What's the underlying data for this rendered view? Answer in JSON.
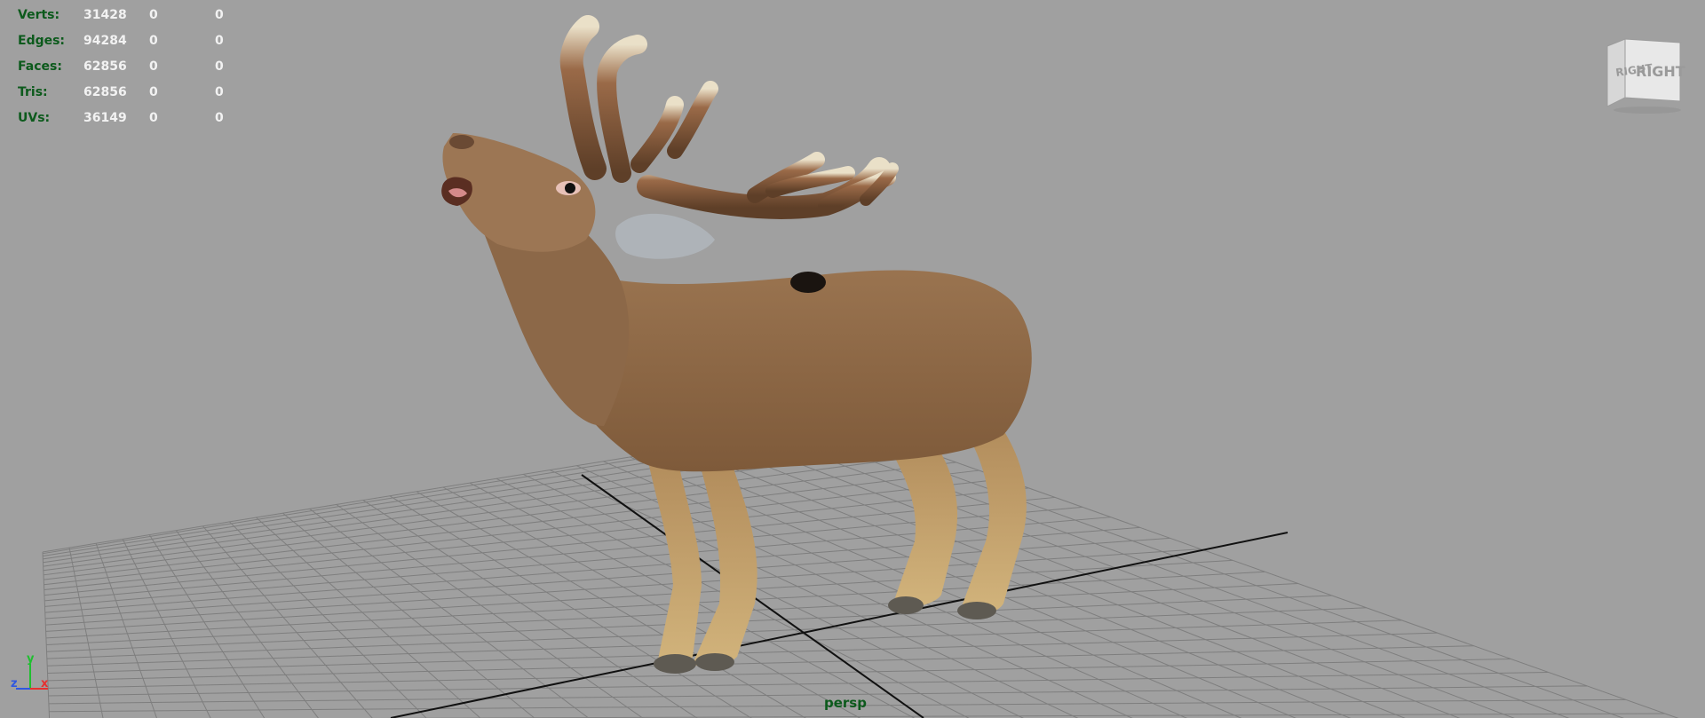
{
  "heads_up_display": {
    "rows": [
      {
        "label": "Verts:",
        "values": [
          "31428",
          "0",
          "0"
        ]
      },
      {
        "label": "Edges:",
        "values": [
          "94284",
          "0",
          "0"
        ]
      },
      {
        "label": "Faces:",
        "values": [
          "62856",
          "0",
          "0"
        ]
      },
      {
        "label": "Tris:",
        "values": [
          "62856",
          "0",
          "0"
        ]
      },
      {
        "label": "UVs:",
        "values": [
          "36149",
          "0",
          "0"
        ]
      }
    ]
  },
  "camera_label": "persp",
  "view_cube": {
    "face_front": "RIGHT",
    "face_side": "RIGHT"
  },
  "axis_indicator": {
    "x": "x",
    "y": "y",
    "z": "z"
  },
  "colors": {
    "viewport_bg": "#a0a0a0",
    "hud_label": "#0c5a1c",
    "hud_value": "#f2f2f2",
    "grid_line": "#7e7e7e",
    "grid_axis": "#111111"
  },
  "model": {
    "subject": "red deer stag",
    "icon": "deer-model"
  }
}
